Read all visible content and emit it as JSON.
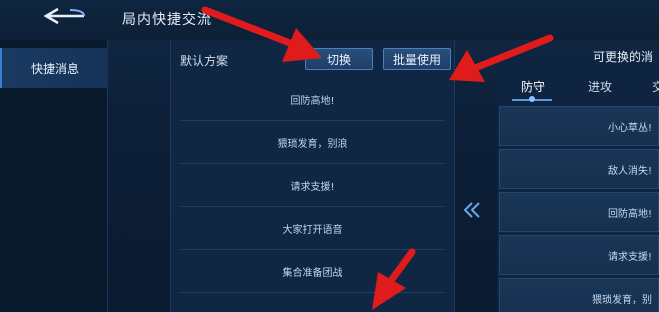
{
  "header": {
    "title": "局内快捷交流"
  },
  "sidebar": {
    "items": [
      {
        "label": "快捷消息"
      }
    ]
  },
  "main": {
    "default_label": "默认方案",
    "switch_label": "切换",
    "batch_label": "批量使用",
    "messages": [
      "回防高地!",
      "猥琐发育，别浪",
      "请求支援!",
      "大家打开语音",
      "集合准备团战"
    ]
  },
  "right": {
    "title": "可更换的消",
    "tabs": [
      "防守",
      "进攻",
      "交"
    ],
    "messages": [
      "小心草丛!",
      "敌人消失!",
      "回防高地!",
      "请求支援!",
      "猥琐发育，别"
    ]
  },
  "icons": {
    "back": "back-arrow-icon",
    "move_left": "double-chevron-left-icon",
    "annotation": "red-arrow-icon"
  },
  "colors": {
    "annotation_red": "#e01b1b",
    "accent_blue": "#4b7fbd"
  }
}
